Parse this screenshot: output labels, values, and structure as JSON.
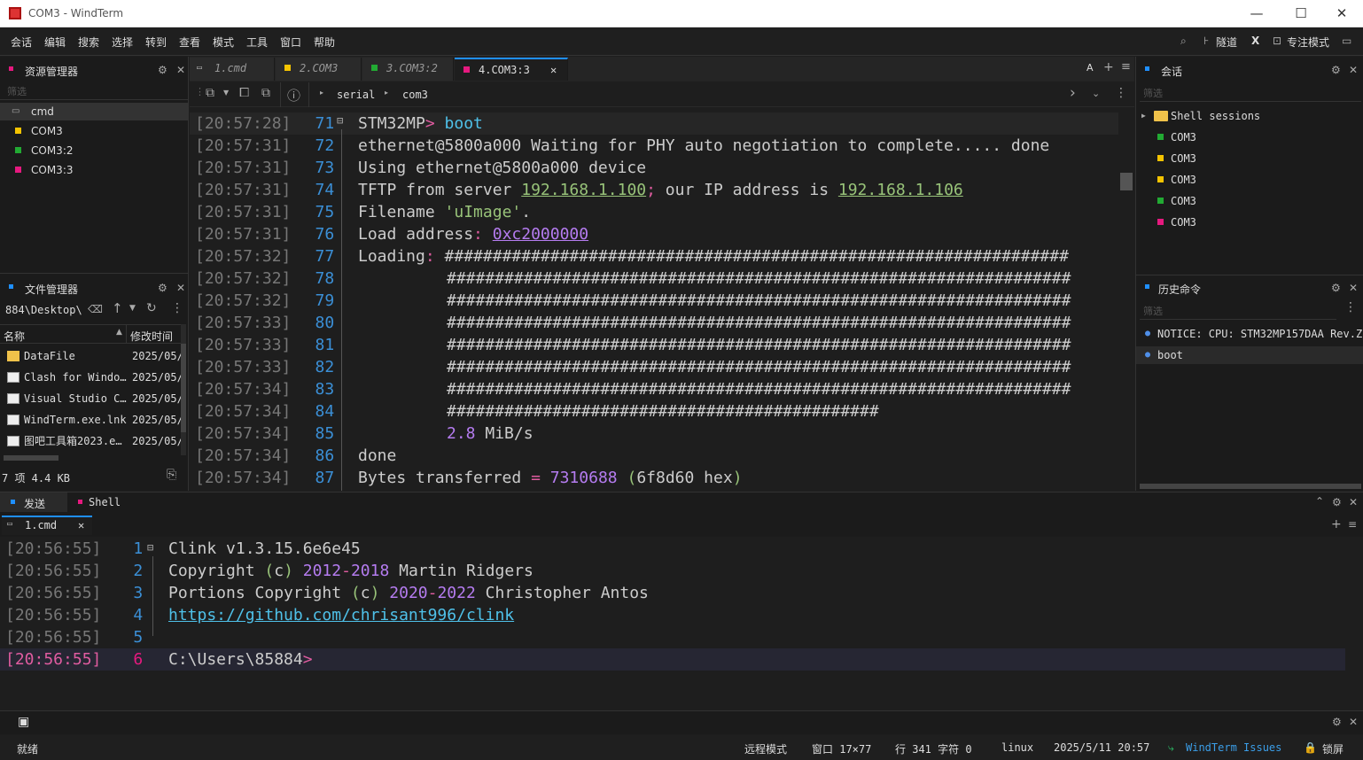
{
  "window": {
    "title": "COM3 - WindTerm",
    "minimize": "—",
    "maximize": "☐",
    "close": "✕"
  },
  "menu": [
    "会话",
    "编辑",
    "搜索",
    "选择",
    "转到",
    "查看",
    "模式",
    "工具",
    "窗口",
    "帮助"
  ],
  "menu_right": {
    "tunnel": "隧道",
    "x": "X",
    "focus": "专注模式"
  },
  "explorer": {
    "title": "资源管理器",
    "filter": "筛选",
    "items": [
      {
        "label": "cmd",
        "color": "#888888"
      },
      {
        "label": "COM3",
        "color": "#f5c400"
      },
      {
        "label": "COM3:2",
        "color": "#22aa33"
      },
      {
        "label": "COM3:3",
        "color": "#e6197f"
      }
    ]
  },
  "filemgr": {
    "title": "文件管理器",
    "path": "884\\Desktop\\",
    "col_name": "名称",
    "col_time": "修改时间",
    "files": [
      {
        "name": "DataFile",
        "time": "2025/05/",
        "icon": "folder-icon"
      },
      {
        "name": "Clash for Windo…",
        "time": "2025/05/",
        "icon": "file-icon"
      },
      {
        "name": "Visual Studio C…",
        "time": "2025/05/",
        "icon": "file-icon"
      },
      {
        "name": "WindTerm.exe.lnk",
        "time": "2025/05/",
        "icon": "file-icon"
      },
      {
        "name": "图吧工具箱2023.e…",
        "time": "2025/05/",
        "icon": "file-icon"
      }
    ],
    "footer": "7 项 4.4 KB"
  },
  "tabs": [
    {
      "label": "1.cmd",
      "color": "#888888"
    },
    {
      "label": "2.COM3",
      "color": "#f5c400"
    },
    {
      "label": "3.COM3:2",
      "color": "#22aa33"
    },
    {
      "label": "4.COM3:3",
      "color": "#e6197f"
    }
  ],
  "breadcrumb": {
    "a": "serial",
    "b": "com3"
  },
  "terminal": [
    {
      "ts": "[20:57:28]",
      "ln": "71"
    },
    {
      "ts": "[20:57:31]",
      "ln": "72"
    },
    {
      "ts": "[20:57:31]",
      "ln": "73"
    },
    {
      "ts": "[20:57:31]",
      "ln": "74"
    },
    {
      "ts": "[20:57:31]",
      "ln": "75"
    },
    {
      "ts": "[20:57:31]",
      "ln": "76"
    },
    {
      "ts": "[20:57:32]",
      "ln": "77"
    },
    {
      "ts": "[20:57:32]",
      "ln": "78"
    },
    {
      "ts": "[20:57:32]",
      "ln": "79"
    },
    {
      "ts": "[20:57:33]",
      "ln": "80"
    },
    {
      "ts": "[20:57:33]",
      "ln": "81"
    },
    {
      "ts": "[20:57:33]",
      "ln": "82"
    },
    {
      "ts": "[20:57:34]",
      "ln": "83"
    },
    {
      "ts": "[20:57:34]",
      "ln": "84"
    },
    {
      "ts": "[20:57:34]",
      "ln": "85"
    },
    {
      "ts": "[20:57:34]",
      "ln": "86"
    },
    {
      "ts": "[20:57:34]",
      "ln": "87"
    }
  ],
  "term_text": {
    "l71_prompt": "STM32MP",
    "l71_gt": ">",
    "l71_cmd": "boot",
    "l72": "ethernet@5800a000 Waiting for PHY auto negotiation to complete..... done",
    "l73": "Using ethernet@5800a000 device",
    "l74a": "TFTP from server ",
    "l74ip1": "192.168.1.100",
    "l74b": ";",
    "l74c": " our IP address is ",
    "l74ip2": "192.168.1.106",
    "l75a": "Filename ",
    "l75b": "'uImage'",
    "l75c": ".",
    "l76a": "Load address",
    "l76b": ": ",
    "l76c": "0xc2000000",
    "l77a": "Loading",
    "l77b": ": ",
    "hash_full": "#################################################################",
    "hash_short": "#############################################",
    "l85a": "2.8",
    "l85b": " MiB/s",
    "l86": "done",
    "l87a": "Bytes transferred ",
    "l87b": "=",
    "l87c": " 7310688",
    "l87d": " (",
    "l87e": "6f8d60 hex",
    "l87f": ")"
  },
  "sessions": {
    "title": "会话",
    "filter": "筛选",
    "group": "Shell sessions",
    "items": [
      {
        "label": "COM3",
        "color": "#22aa33"
      },
      {
        "label": "COM3",
        "color": "#f5c400"
      },
      {
        "label": "COM3",
        "color": "#f5c400"
      },
      {
        "label": "COM3",
        "color": "#22aa33"
      },
      {
        "label": "COM3",
        "color": "#e6197f"
      }
    ]
  },
  "history": {
    "title": "历史命令",
    "filter": "筛选",
    "items": [
      "NOTICE: CPU: STM32MP157DAA Rev.Z",
      "boot"
    ]
  },
  "bottom": {
    "tab_send": "发送",
    "tab_shell": "Shell",
    "subtab": "1.cmd",
    "lines": [
      {
        "ts": "[20:56:55]",
        "ln": "1"
      },
      {
        "ts": "[20:56:55]",
        "ln": "2"
      },
      {
        "ts": "[20:56:55]",
        "ln": "3"
      },
      {
        "ts": "[20:56:55]",
        "ln": "4"
      },
      {
        "ts": "[20:56:55]",
        "ln": "5"
      },
      {
        "ts": "[20:56:55]",
        "ln": "6"
      }
    ],
    "t1": "Clink v1.3.15.6e6e45",
    "t2a": "Copyright ",
    "t2b": "(",
    "t2c": "c",
    "t2d": ")",
    "t2e": " 2012",
    "t2f": "-",
    "t2g": "2018",
    "t2h": " Martin Ridgers",
    "t3a": "Portions Copyright ",
    "t3b": "(",
    "t3c": "c",
    "t3d": ")",
    "t3e": " 2020",
    "t3f": "-",
    "t3g": "2022",
    "t3h": " Christopher Antos",
    "t4": "https://github.com/chrisant996/clink",
    "t6a": "C:\\Users\\85884",
    "t6b": ">"
  },
  "status": {
    "ready": "就绪",
    "mode": "远程模式",
    "window": "窗口 17×77",
    "pos": "行 341 字符 0",
    "os": "linux",
    "datetime": "2025/5/11 20:57",
    "issues": "WindTerm Issues",
    "lock": "锁屏"
  }
}
